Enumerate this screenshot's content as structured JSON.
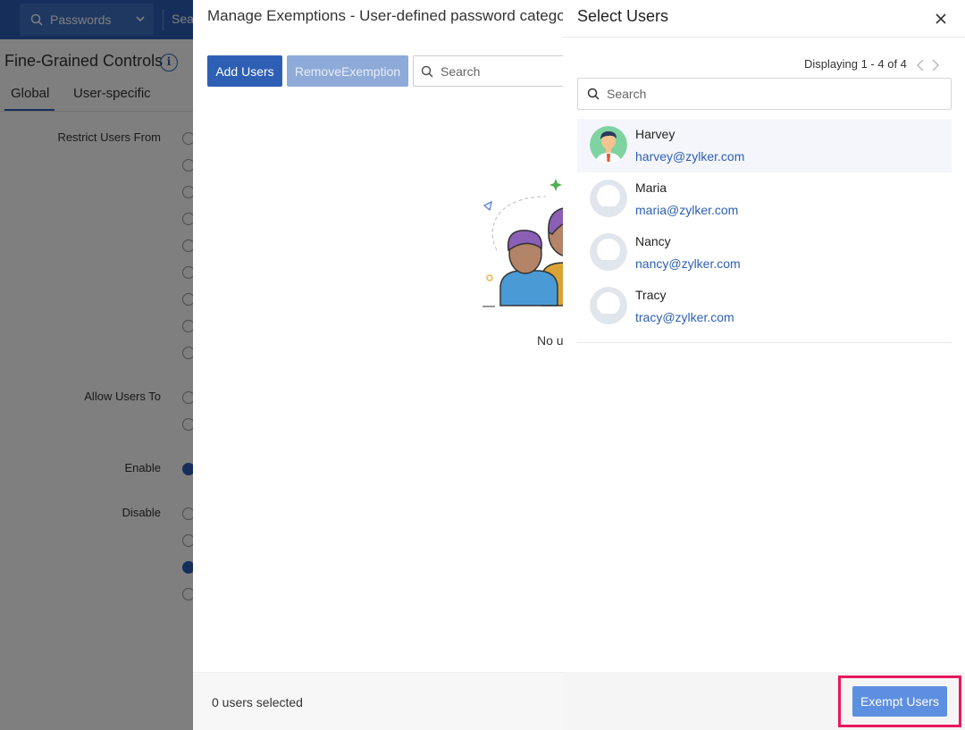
{
  "topbar": {
    "search_scope": "Passwords",
    "search_text": "Sear"
  },
  "background": {
    "title": "Fine-Grained Controls",
    "tabs": [
      {
        "label": "Global"
      },
      {
        "label": "User-specific"
      }
    ],
    "sections": {
      "restrict": "Restrict Users From",
      "allow": "Allow Users To",
      "enable": "Enable",
      "disable": "Disable"
    }
  },
  "exemptions_modal": {
    "title": "Manage Exemptions - User-defined password category",
    "add_users_label": "Add Users",
    "remove_exemption_label": "RemoveExemption",
    "search_placeholder": "Search",
    "empty_text": "No u",
    "footer_count": "0 users selected"
  },
  "select_users_panel": {
    "title": "Select Users",
    "display_count": "Displaying 1 - 4 of 4",
    "search_placeholder": "Search",
    "users": [
      {
        "name": "Harvey",
        "email": "harvey@zylker.com",
        "avatar": "photo-avatar"
      },
      {
        "name": "Maria",
        "email": "maria@zylker.com",
        "avatar": "default-avatar"
      },
      {
        "name": "Nancy",
        "email": "nancy@zylker.com",
        "avatar": "default-avatar"
      },
      {
        "name": "Tracy",
        "email": "tracy@zylker.com",
        "avatar": "default-avatar"
      }
    ],
    "exempt_button_label": "Exempt Users"
  },
  "colors": {
    "primary": "#2d5fb5",
    "exempt_button": "#5d8fe0",
    "highlight": "#e8185e"
  }
}
